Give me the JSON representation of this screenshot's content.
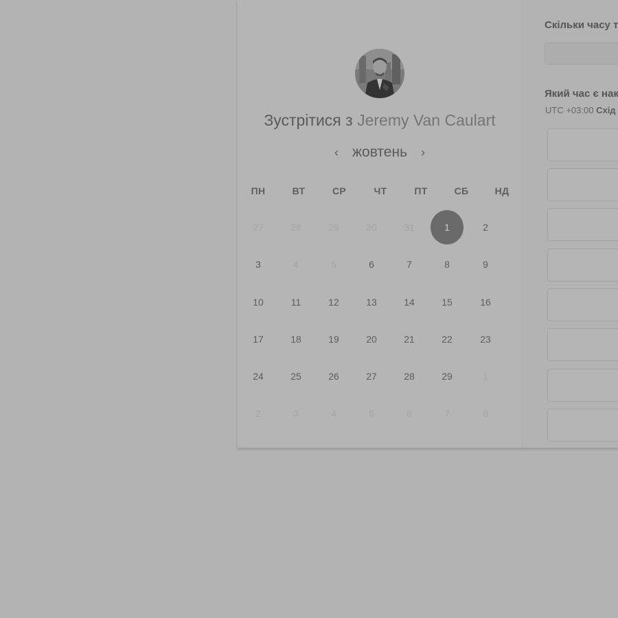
{
  "scheduler": {
    "title_prefix": "Зустрітися з",
    "host_name": "Jeremy Van Caulart",
    "month": "жовтень",
    "weekdays": [
      "ПН",
      "ВТ",
      "СР",
      "ЧТ",
      "ПТ",
      "СБ",
      "НД"
    ],
    "weeks": [
      [
        {
          "d": "27",
          "m": true
        },
        {
          "d": "28",
          "m": true
        },
        {
          "d": "29",
          "m": true
        },
        {
          "d": "30",
          "m": true
        },
        {
          "d": "31",
          "m": true
        },
        {
          "d": "1",
          "s": true
        },
        {
          "d": "2"
        }
      ],
      [
        {
          "d": "3"
        },
        {
          "d": "4",
          "m": true
        },
        {
          "d": "5",
          "m": true
        },
        {
          "d": "6"
        },
        {
          "d": "7"
        },
        {
          "d": "8"
        },
        {
          "d": "9"
        }
      ],
      [
        {
          "d": "10"
        },
        {
          "d": "11"
        },
        {
          "d": "12"
        },
        {
          "d": "13"
        },
        {
          "d": "14"
        },
        {
          "d": "15"
        },
        {
          "d": "16"
        }
      ],
      [
        {
          "d": "17"
        },
        {
          "d": "18"
        },
        {
          "d": "19"
        },
        {
          "d": "20"
        },
        {
          "d": "21"
        },
        {
          "d": "22"
        },
        {
          "d": "23"
        }
      ],
      [
        {
          "d": "24"
        },
        {
          "d": "25"
        },
        {
          "d": "26"
        },
        {
          "d": "27"
        },
        {
          "d": "28"
        },
        {
          "d": "29"
        },
        {
          "d": "1",
          "m": true
        }
      ],
      [
        {
          "d": "2",
          "m": true
        },
        {
          "d": "3",
          "m": true
        },
        {
          "d": "4",
          "m": true
        },
        {
          "d": "5",
          "m": true
        },
        {
          "d": "6",
          "m": true
        },
        {
          "d": "7",
          "m": true
        },
        {
          "d": "8",
          "m": true
        }
      ]
    ]
  },
  "panel": {
    "duration_label": "Скільки часу т",
    "time_label": "Який час є нак",
    "tz_offset": "UTC +03:00",
    "tz_name": "Схід"
  },
  "colors": {
    "overlay_bg": "#b3b3b3",
    "selected_day": "#6a6a6a"
  },
  "icons": {
    "prev": "chevron-left-icon",
    "next": "chevron-right-icon"
  }
}
